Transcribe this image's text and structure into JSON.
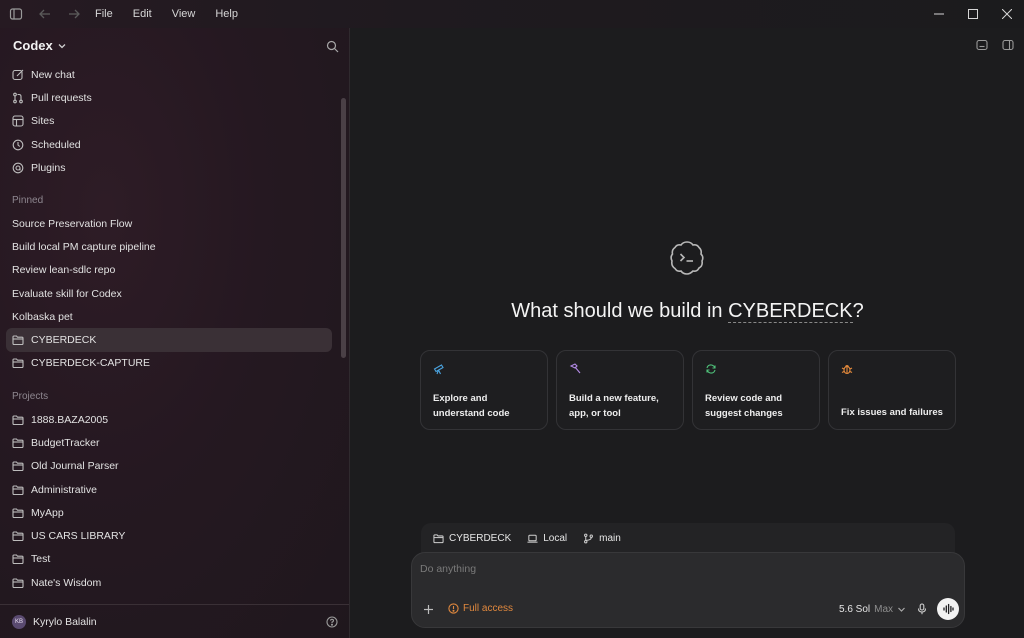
{
  "titlebar": {
    "menus": [
      "File",
      "Edit",
      "View",
      "Help"
    ]
  },
  "sidebar": {
    "title": "Codex",
    "nav": [
      {
        "label": "New chat",
        "icon": "edit-icon"
      },
      {
        "label": "Pull requests",
        "icon": "pull-request-icon"
      },
      {
        "label": "Sites",
        "icon": "sites-icon"
      },
      {
        "label": "Scheduled",
        "icon": "clock-icon"
      },
      {
        "label": "Plugins",
        "icon": "plugin-icon"
      }
    ],
    "pinned_label": "Pinned",
    "pinned": [
      "Source Preservation Flow",
      "Build local PM capture pipeline",
      "Review lean-sdlc repo",
      "Evaluate skill for Codex",
      "Kolbaska pet",
      "CYBERDECK",
      "CYBERDECK-CAPTURE"
    ],
    "projects_label": "Projects",
    "projects": [
      "1888.BAZA2005",
      "BudgetTracker",
      "Old Journal Parser",
      "Administrative",
      "MyApp",
      "US CARS LIBRARY",
      "Test",
      "Nate's Wisdom"
    ],
    "user": {
      "initials": "KB",
      "name": "Kyrylo Balalin"
    }
  },
  "main": {
    "headline_prefix": "What should we build in ",
    "headline_project": "CYBERDECK",
    "headline_suffix": "?",
    "cards": [
      {
        "line1": "Explore and",
        "line2": "understand code",
        "icon": "telescope-icon",
        "color": "#4aa3df"
      },
      {
        "line1": "Build a new feature,",
        "line2": "app, or tool",
        "icon": "hammer-icon",
        "color": "#b38ae6"
      },
      {
        "line1": "Review code and",
        "line2": "suggest changes",
        "icon": "refresh-icon",
        "color": "#4fc17a"
      },
      {
        "line1": "Fix issues and failures",
        "line2": "",
        "icon": "bug-icon",
        "color": "#e58a3c"
      }
    ],
    "context": {
      "folder": "CYBERDECK",
      "environment": "Local",
      "branch": "main"
    },
    "composer": {
      "placeholder": "Do anything",
      "access": "Full access",
      "model": "5.6 Sol",
      "effort": "Max"
    }
  }
}
